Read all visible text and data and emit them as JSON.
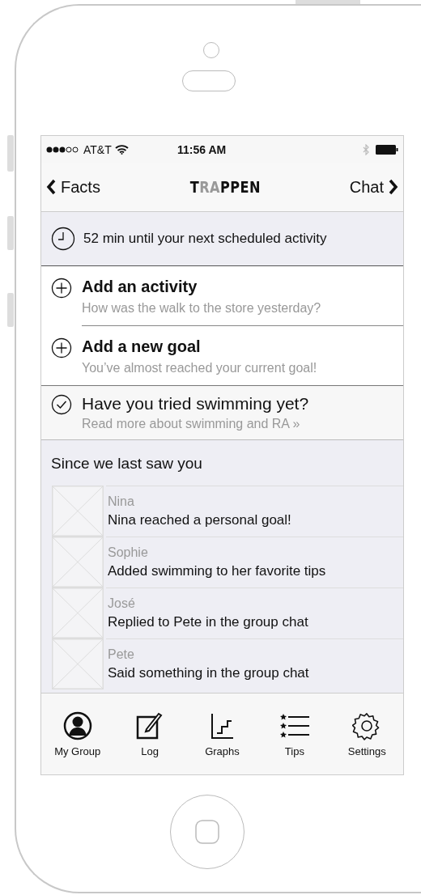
{
  "status_bar": {
    "carrier": "AT&T",
    "time": "11:56 AM"
  },
  "nav": {
    "back": "Facts",
    "logo": [
      {
        "text": "T",
        "muted": false
      },
      {
        "text": "RA",
        "muted": true
      },
      {
        "text": "PPEN",
        "muted": false
      }
    ],
    "forward": "Chat"
  },
  "banner": {
    "text": "52 min until your next scheduled activity"
  },
  "actions": [
    {
      "kind": "add",
      "title": "Add an activity",
      "subtitle": "How was the walk to the store yesterday?"
    },
    {
      "kind": "add",
      "title": "Add a new goal",
      "subtitle": "You’ve almost reached your current goal!"
    },
    {
      "kind": "tip",
      "title": "Have you tried swimming yet?",
      "subtitle": "Read more about swimming and RA »"
    }
  ],
  "feed": {
    "title": "Since we last saw you",
    "items": [
      {
        "name": "Nina",
        "text": "Nina reached a personal goal!"
      },
      {
        "name": "Sophie",
        "text": "Added swimming to her favorite tips"
      },
      {
        "name": "José",
        "text": "Replied to Pete in the group chat"
      },
      {
        "name": "Pete",
        "text": "Said something in the group chat"
      }
    ]
  },
  "tab_bar": [
    {
      "kind": "group",
      "label": "My Group"
    },
    {
      "kind": "log",
      "label": "Log"
    },
    {
      "kind": "graphs",
      "label": "Graphs"
    },
    {
      "kind": "tips",
      "label": "Tips"
    },
    {
      "kind": "settings",
      "label": "Settings"
    }
  ]
}
